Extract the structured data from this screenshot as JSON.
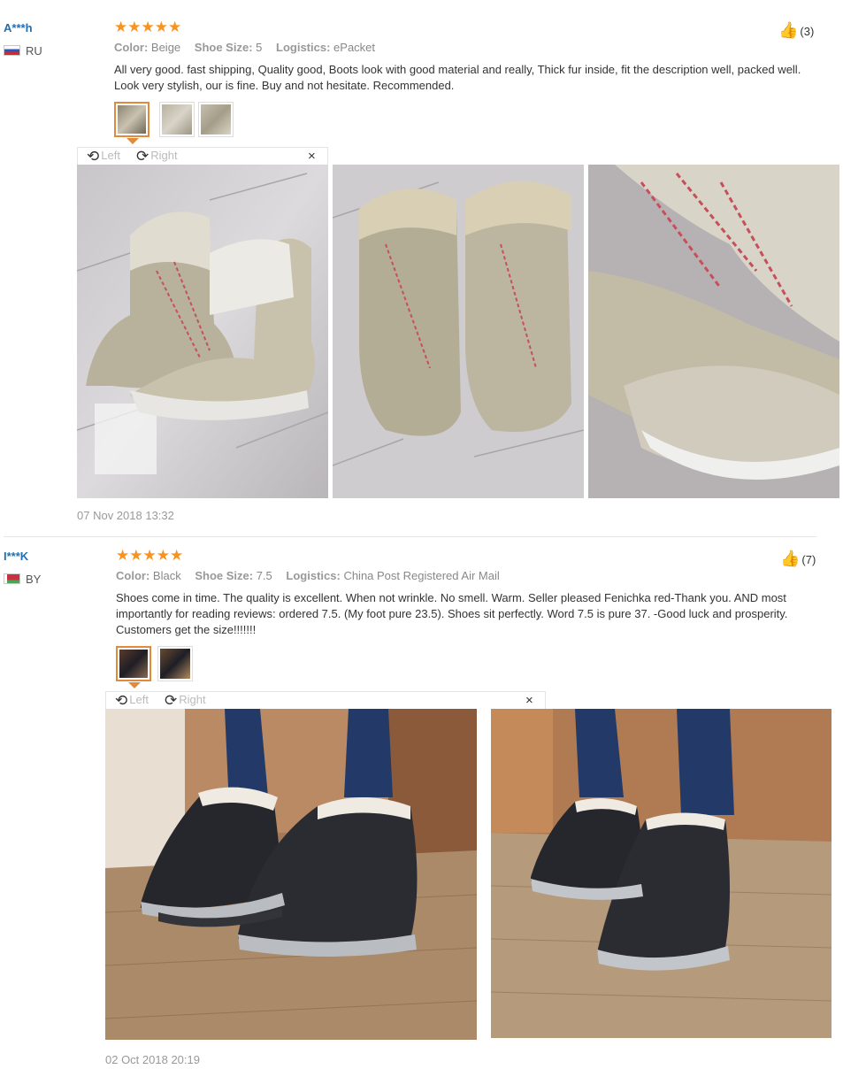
{
  "reviews": [
    {
      "user": "A***h",
      "country": "RU",
      "rating_stars": "★★★★★",
      "color_label": "Color:",
      "color": "Beige",
      "size_label": "Shoe Size:",
      "size": "5",
      "logistics_label": "Logistics:",
      "logistics": "ePacket",
      "text": "All very good. fast shipping, Quality good, Boots look with good material and really, Thick fur inside, fit the description well, packed well. Look very stylish, our is fine. Buy and not hesitate. Recommended.",
      "likes": "(3)",
      "rotate_left": "Left",
      "rotate_right": "Right",
      "close": "×",
      "date": "07 Nov 2018 13:32"
    },
    {
      "user": "I***K",
      "country": "BY",
      "rating_stars": "★★★★★",
      "color_label": "Color:",
      "color": "Black",
      "size_label": "Shoe Size:",
      "size": "7.5",
      "logistics_label": "Logistics:",
      "logistics": "China Post Registered Air Mail",
      "text": "Shoes come in time. The quality is excellent. When not wrinkle. No smell. Warm. Seller pleased Fenichka red-Thank you. AND most importantly for reading reviews: ordered 7.5. (My foot pure 23.5). Shoes sit perfectly. Word 7.5 is pure 37. -Good luck and prosperity. Customers get the size!!!!!!!",
      "likes": "(7)",
      "rotate_left": "Left",
      "rotate_right": "Right",
      "close": "×",
      "date": "02 Oct 2018 20:19"
    }
  ],
  "icons": {
    "rotate_left": "⟲",
    "rotate_right": "⟳",
    "thumbs_up": "👍"
  },
  "colors": {
    "username": "#1f6fb2",
    "stars": "#f7931e",
    "thumb_active_border": "#e08a3a"
  }
}
